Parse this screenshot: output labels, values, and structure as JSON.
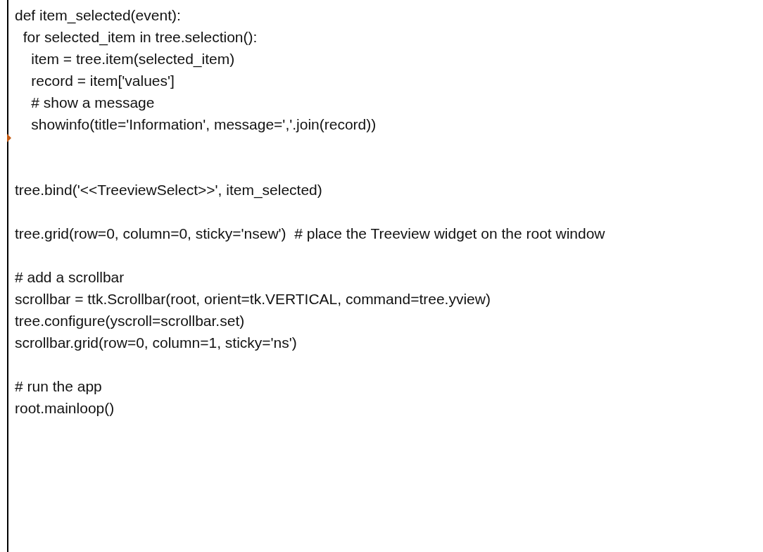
{
  "code_blocks": [
    {
      "kind": "function",
      "lines": [
        "def item_selected(event):",
        "  for selected_item in tree.selection():",
        "    item = tree.item(selected_item)",
        "    record = item['values']",
        "    # show a message",
        "    showinfo(title='Information', message=','.join(record))"
      ]
    },
    {
      "kind": "statement",
      "lines": [
        "tree.bind('<<TreeviewSelect>>', item_selected)"
      ]
    },
    {
      "kind": "statement",
      "lines": [
        "tree.grid(row=0, column=0, sticky='nsew')  # place the Treeview widget on the root window"
      ]
    },
    {
      "kind": "statement",
      "lines": [
        "# add a scrollbar",
        "scrollbar = ttk.Scrollbar(root, orient=tk.VERTICAL, command=tree.yview)",
        "tree.configure(yscroll=scrollbar.set)",
        "scrollbar.grid(row=0, column=1, sticky='ns')"
      ]
    },
    {
      "kind": "statement",
      "lines": [
        "# run the app",
        "root.mainloop()"
      ]
    }
  ]
}
